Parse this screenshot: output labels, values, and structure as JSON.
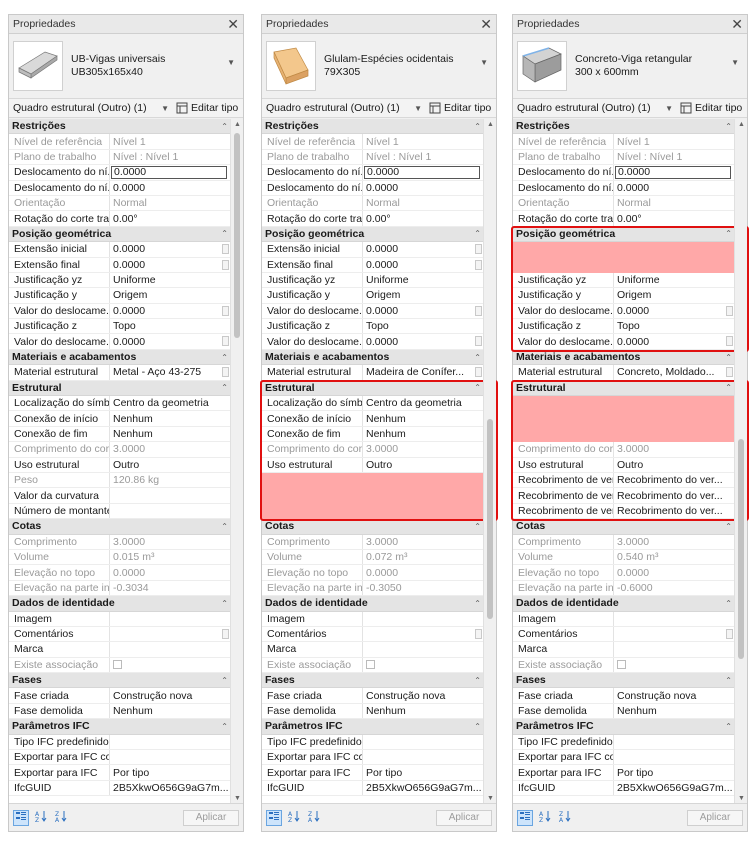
{
  "panels": [
    {
      "title": "Propriedades",
      "type_line1": "UB-Vigas universais",
      "type_line2": "UB305x165x40",
      "thumb": "steel-i-beam",
      "filter": "Quadro estrutural (Outro) (1)",
      "edit_type": "Editar tipo",
      "apply": "Aplicar",
      "rows": [
        {
          "s": "Restrições"
        },
        {
          "k": "Nível de referência",
          "v": "Nível 1",
          "d": 1
        },
        {
          "k": "Plano de trabalho",
          "v": "Nível : Nível 1",
          "d": 1
        },
        {
          "k": "Deslocamento do ní...",
          "v": "0.0000",
          "e": 1
        },
        {
          "k": "Deslocamento do ní...",
          "v": "0.0000"
        },
        {
          "k": "Orientação",
          "v": "Normal",
          "d": 1
        },
        {
          "k": "Rotação do corte tra...",
          "v": "0.00°"
        },
        {
          "s": "Posição geométrica"
        },
        {
          "k": "Extensão inicial",
          "v": "0.0000",
          "m": 1
        },
        {
          "k": "Extensão final",
          "v": "0.0000",
          "m": 1
        },
        {
          "k": "Justificação yz",
          "v": "Uniforme"
        },
        {
          "k": "Justificação y",
          "v": "Origem"
        },
        {
          "k": "Valor do deslocame...",
          "v": "0.0000",
          "m": 1
        },
        {
          "k": "Justificação z",
          "v": "Topo"
        },
        {
          "k": "Valor do deslocame...",
          "v": "0.0000",
          "m": 1
        },
        {
          "s": "Materiais e acabamentos"
        },
        {
          "k": "Material estrutural",
          "v": "Metal - Aço 43-275",
          "m": 1
        },
        {
          "s": "Estrutural"
        },
        {
          "k": "Localização do símb...",
          "v": "Centro da geometria"
        },
        {
          "k": "Conexão de início",
          "v": "Nenhum"
        },
        {
          "k": "Conexão de fim",
          "v": "Nenhum"
        },
        {
          "k": "Comprimento do cor...",
          "v": "3.0000",
          "d": 1
        },
        {
          "k": "Uso estrutural",
          "v": "Outro"
        },
        {
          "k": "Peso",
          "v": "120.86 kg",
          "d": 1
        },
        {
          "k": "Valor da curvatura",
          "v": ""
        },
        {
          "k": "Número de montantes",
          "v": ""
        },
        {
          "s": "Cotas"
        },
        {
          "k": "Comprimento",
          "v": "3.0000",
          "d": 1
        },
        {
          "k": "Volume",
          "v": "0.015 m³",
          "d": 1
        },
        {
          "k": "Elevação no topo",
          "v": "0.0000",
          "d": 1
        },
        {
          "k": "Elevação na parte inf...",
          "v": "-0.3034",
          "d": 1
        },
        {
          "s": "Dados de identidade"
        },
        {
          "k": "Imagem",
          "v": ""
        },
        {
          "k": "Comentários",
          "v": "",
          "m": 1
        },
        {
          "k": "Marca",
          "v": ""
        },
        {
          "k": "Existe associação",
          "v": "",
          "d": 1,
          "c": 1
        },
        {
          "s": "Fases"
        },
        {
          "k": "Fase criada",
          "v": "Construção nova"
        },
        {
          "k": "Fase demolida",
          "v": "Nenhum"
        },
        {
          "s": "Parâmetros IFC"
        },
        {
          "k": "Tipo IFC predefinido",
          "v": ""
        },
        {
          "k": "Exportar para IFC co...",
          "v": ""
        },
        {
          "k": "Exportar para IFC",
          "v": "Por tipo"
        },
        {
          "k": "IfcGUID",
          "v": "2B5XkwO656G9aG7m..."
        }
      ]
    },
    {
      "title": "Propriedades",
      "type_line1": "Glulam-Espécies ocidentais",
      "type_line2": "79X305",
      "thumb": "glulam-beam",
      "filter": "Quadro estrutural (Outro) (1)",
      "edit_type": "Editar tipo",
      "apply": "Aplicar",
      "rows": [
        {
          "s": "Restrições"
        },
        {
          "k": "Nível de referência",
          "v": "Nível 1",
          "d": 1
        },
        {
          "k": "Plano de trabalho",
          "v": "Nível : Nível 1",
          "d": 1
        },
        {
          "k": "Deslocamento do ní...",
          "v": "0.0000",
          "e": 1
        },
        {
          "k": "Deslocamento do ní...",
          "v": "0.0000"
        },
        {
          "k": "Orientação",
          "v": "Normal",
          "d": 1
        },
        {
          "k": "Rotação do corte tra...",
          "v": "0.00°"
        },
        {
          "s": "Posição geométrica"
        },
        {
          "k": "Extensão inicial",
          "v": "0.0000",
          "m": 1
        },
        {
          "k": "Extensão final",
          "v": "0.0000",
          "m": 1
        },
        {
          "k": "Justificação yz",
          "v": "Uniforme"
        },
        {
          "k": "Justificação y",
          "v": "Origem"
        },
        {
          "k": "Valor do deslocame...",
          "v": "0.0000",
          "m": 1
        },
        {
          "k": "Justificação z",
          "v": "Topo"
        },
        {
          "k": "Valor do deslocame...",
          "v": "0.0000",
          "m": 1
        },
        {
          "s": "Materiais e acabamentos"
        },
        {
          "k": "Material estrutural",
          "v": "Madeira de Conífer...",
          "m": 1
        },
        {
          "s": "Estrutural"
        },
        {
          "k": "Localização do símb...",
          "v": "Centro da geometria"
        },
        {
          "k": "Conexão de início",
          "v": "Nenhum"
        },
        {
          "k": "Conexão de fim",
          "v": "Nenhum"
        },
        {
          "k": "Comprimento do cor...",
          "v": "3.0000",
          "d": 1
        },
        {
          "k": "Uso estrutural",
          "v": "Outro"
        },
        {
          "x": 1
        },
        {
          "x": 1
        },
        {
          "x": 1
        },
        {
          "s": "Cotas"
        },
        {
          "k": "Comprimento",
          "v": "3.0000",
          "d": 1
        },
        {
          "k": "Volume",
          "v": "0.072 m³",
          "d": 1
        },
        {
          "k": "Elevação no topo",
          "v": "0.0000",
          "d": 1
        },
        {
          "k": "Elevação na parte inf...",
          "v": "-0.3050",
          "d": 1
        },
        {
          "s": "Dados de identidade"
        },
        {
          "k": "Imagem",
          "v": ""
        },
        {
          "k": "Comentários",
          "v": "",
          "m": 1
        },
        {
          "k": "Marca",
          "v": ""
        },
        {
          "k": "Existe associação",
          "v": "",
          "d": 1,
          "c": 1
        },
        {
          "s": "Fases"
        },
        {
          "k": "Fase criada",
          "v": "Construção nova"
        },
        {
          "k": "Fase demolida",
          "v": "Nenhum"
        },
        {
          "s": "Parâmetros IFC"
        },
        {
          "k": "Tipo IFC predefinido",
          "v": ""
        },
        {
          "k": "Exportar para IFC co...",
          "v": ""
        },
        {
          "k": "Exportar para IFC",
          "v": "Por tipo"
        },
        {
          "k": "IfcGUID",
          "v": "2B5XkwO656G9aG7m..."
        }
      ]
    },
    {
      "title": "Propriedades",
      "type_line1": "Concreto-Viga retangular",
      "type_line2": "300 x 600mm",
      "thumb": "concrete-beam",
      "filter": "Quadro estrutural (Outro) (1)",
      "edit_type": "Editar tipo",
      "apply": "Aplicar",
      "rows": [
        {
          "s": "Restrições"
        },
        {
          "k": "Nível de referência",
          "v": "Nível 1",
          "d": 1
        },
        {
          "k": "Plano de trabalho",
          "v": "Nível : Nível 1",
          "d": 1
        },
        {
          "k": "Deslocamento do ní...",
          "v": "0.0000",
          "e": 1
        },
        {
          "k": "Deslocamento do ní...",
          "v": "0.0000"
        },
        {
          "k": "Orientação",
          "v": "Normal",
          "d": 1
        },
        {
          "k": "Rotação do corte tra...",
          "v": "0.00°"
        },
        {
          "s": "Posição geométrica"
        },
        {
          "x": 1
        },
        {
          "x": 1
        },
        {
          "k": "Justificação yz",
          "v": "Uniforme"
        },
        {
          "k": "Justificação y",
          "v": "Origem"
        },
        {
          "k": "Valor do deslocame...",
          "v": "0.0000",
          "m": 1
        },
        {
          "k": "Justificação z",
          "v": "Topo"
        },
        {
          "k": "Valor do deslocame...",
          "v": "0.0000",
          "m": 1
        },
        {
          "s": "Materiais e acabamentos"
        },
        {
          "k": "Material estrutural",
          "v": "Concreto, Moldado...",
          "m": 1
        },
        {
          "s": "Estrutural"
        },
        {
          "x": 1
        },
        {
          "x": 1
        },
        {
          "x": 1
        },
        {
          "k": "Comprimento do cor...",
          "v": "3.0000",
          "d": 1
        },
        {
          "k": "Uso estrutural",
          "v": "Outro"
        },
        {
          "k": "Recobrimento de ver...",
          "v": "Recobrimento do ver..."
        },
        {
          "k": "Recobrimento de ver...",
          "v": "Recobrimento do ver..."
        },
        {
          "k": "Recobrimento de ver...",
          "v": "Recobrimento do ver..."
        },
        {
          "s": "Cotas"
        },
        {
          "k": "Comprimento",
          "v": "3.0000",
          "d": 1
        },
        {
          "k": "Volume",
          "v": "0.540 m³",
          "d": 1
        },
        {
          "k": "Elevação no topo",
          "v": "0.0000",
          "d": 1
        },
        {
          "k": "Elevação na parte inf...",
          "v": "-0.6000",
          "d": 1
        },
        {
          "s": "Dados de identidade"
        },
        {
          "k": "Imagem",
          "v": ""
        },
        {
          "k": "Comentários",
          "v": "",
          "m": 1
        },
        {
          "k": "Marca",
          "v": ""
        },
        {
          "k": "Existe associação",
          "v": "",
          "d": 1,
          "c": 1
        },
        {
          "s": "Fases"
        },
        {
          "k": "Fase criada",
          "v": "Construção nova"
        },
        {
          "k": "Fase demolida",
          "v": "Nenhum"
        },
        {
          "s": "Parâmetros IFC"
        },
        {
          "k": "Tipo IFC predefinido",
          "v": ""
        },
        {
          "k": "Exportar para IFC co...",
          "v": ""
        },
        {
          "k": "Exportar para IFC",
          "v": "Por tipo"
        },
        {
          "k": "IfcGUID",
          "v": "2B5XkwO656G9aG7m..."
        }
      ]
    }
  ],
  "colors": {
    "highlight_red": "#e01010",
    "mask_pink": "#ffa8a8",
    "section_bg": "#e4e4e4",
    "active_sort": "#cde4fb"
  }
}
